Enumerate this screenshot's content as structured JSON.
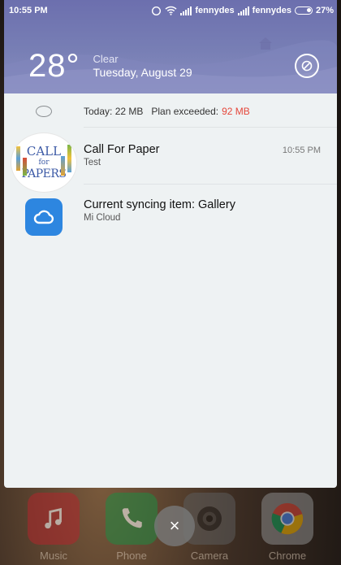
{
  "status_bar": {
    "time": "10:55 PM",
    "carrier_1": "fennydes",
    "carrier_2": "fennydes",
    "battery_percent": "27%",
    "battery_level": 0.27,
    "icons": [
      "alarm-icon",
      "wifi-icon",
      "signal-icon",
      "signal-icon",
      "battery-icon"
    ]
  },
  "weather": {
    "temperature": "28°",
    "condition": "Clear",
    "date": "Tuesday, August 29"
  },
  "header_actions": {
    "do_not_disturb_icon": "dnd-icon"
  },
  "data_usage": {
    "today_label": "Today: 22 MB",
    "plan_label": "Plan exceeded:",
    "exceeded_value": "92 MB",
    "exceeded_color": "#e5473b"
  },
  "notifications": [
    {
      "title": "Call For Paper",
      "subtitle": "Test",
      "time": "10:55 PM",
      "icon_text": [
        "CALL",
        "for",
        "PAPERS"
      ]
    },
    {
      "title": "Current syncing item: Gallery",
      "subtitle": "Mi Cloud",
      "time": "",
      "icon": "cloud-icon",
      "icon_color": "#2d86e0"
    }
  ],
  "dock": [
    {
      "label": "Music",
      "icon": "music-icon"
    },
    {
      "label": "Phone",
      "icon": "phone-icon"
    },
    {
      "label": "Camera",
      "icon": "camera-icon"
    },
    {
      "label": "Chrome",
      "icon": "chrome-icon"
    }
  ],
  "close_button": {
    "glyph": "×"
  }
}
